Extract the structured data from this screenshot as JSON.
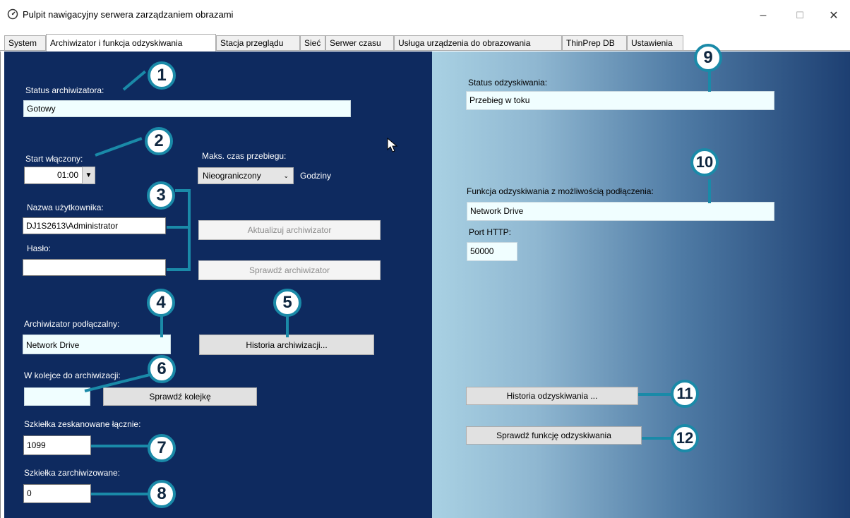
{
  "window": {
    "title": "Pulpit nawigacyjny serwera zarządzaniem obrazami",
    "minimize": "–",
    "maximize": "☐",
    "close": "✕"
  },
  "tabs": [
    {
      "label": "System"
    },
    {
      "label": "Archiwizator i funkcja odzyskiwania"
    },
    {
      "label": "Stacja przeglądu"
    },
    {
      "label": "Sieć"
    },
    {
      "label": "Serwer czasu"
    },
    {
      "label": "Usługa urządzenia do obrazowania"
    },
    {
      "label": "ThinPrep DB"
    },
    {
      "label": "Ustawienia"
    }
  ],
  "archiver": {
    "status_label": "Status archiwizatora:",
    "status_value": "Gotowy",
    "start_label": "Start włączony:",
    "start_value": "01:00",
    "max_time_label": "Maks. czas przebiegu:",
    "max_time_value": "Nieograniczony",
    "hours_label": "Godziny",
    "username_label": "Nazwa użytkownika:",
    "username_value": "DJ1S2613\\Administrator",
    "password_label": "Hasło:",
    "password_value": "",
    "update_button": "Aktualizuj archiwizator",
    "check_button": "Sprawdź archiwizator",
    "plugin_label": "Archiwizator podłączalny:",
    "plugin_value": "Network Drive",
    "history_button": "Historia archiwizacji...",
    "queue_label": "W kolejce do archiwizacji:",
    "queue_value": "",
    "check_queue_button": "Sprawdź kolejkę",
    "scanned_label": "Szkiełka zeskanowane łącznie:",
    "scanned_value": "1099",
    "archived_label": "Szkiełka zarchiwizowane:",
    "archived_value": "0"
  },
  "retrieval": {
    "status_label": "Status odzyskiwania:",
    "status_value": "Przebieg w toku",
    "plugin_label": "Funkcja odzyskiwania z możliwością podłączenia:",
    "plugin_value": "Network Drive",
    "port_label": "Port HTTP:",
    "port_value": "50000",
    "history_button": "Historia odzyskiwania ...",
    "check_button": "Sprawdź funkcję odzyskiwania"
  },
  "callouts": [
    "1",
    "2",
    "3",
    "4",
    "5",
    "6",
    "7",
    "8",
    "9",
    "10",
    "11",
    "12"
  ],
  "colors": {
    "left_panel": "#0e2a5f",
    "callout_ring": "#1a8aa8",
    "field_bg": "#f0feff"
  },
  "icons": {
    "app": "dashboard-gauge-icon",
    "dropdown": "chevron-down-icon",
    "cursor": "mouse-pointer-icon"
  }
}
